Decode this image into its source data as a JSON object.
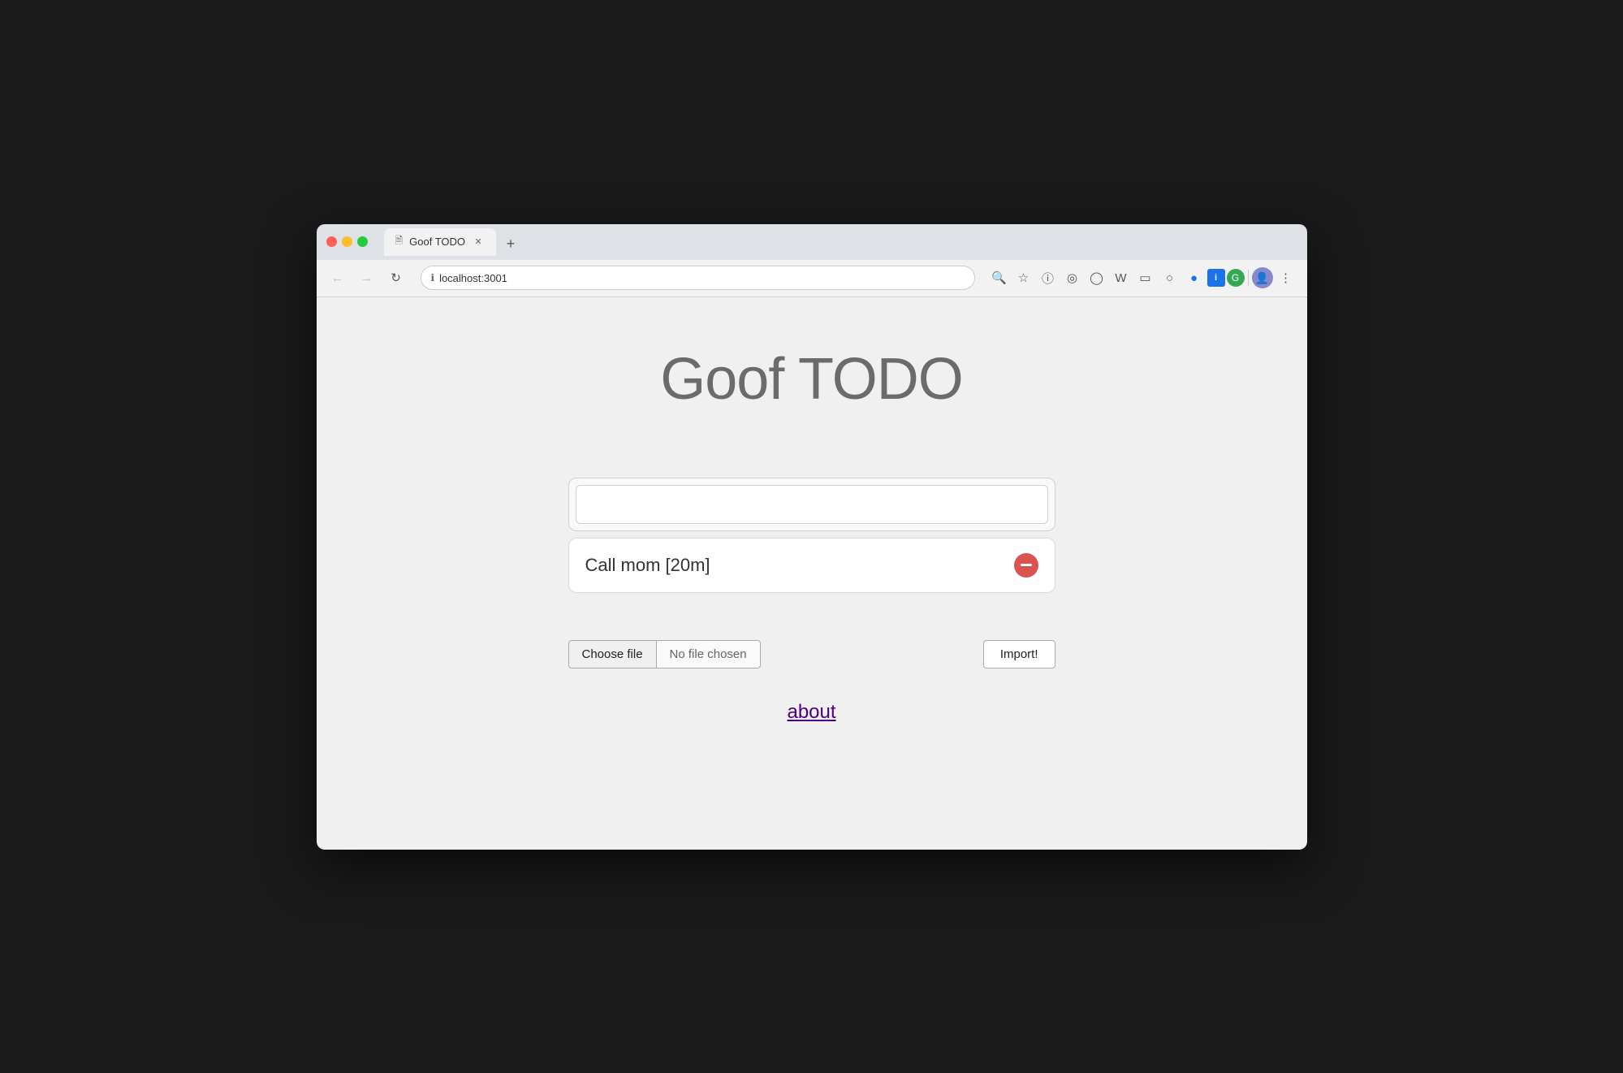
{
  "browser": {
    "tab_title": "Goof TODO",
    "url": "localhost:3001",
    "new_tab_symbol": "+",
    "back_symbol": "←",
    "forward_symbol": "→",
    "refresh_symbol": "↻"
  },
  "app": {
    "title": "Goof TODO",
    "input_placeholder": "",
    "todo_items": [
      {
        "text": "Call mom [20m]"
      }
    ],
    "file_input": {
      "choose_label": "Choose file",
      "no_file_text": "No file chosen"
    },
    "import_button": "Import!",
    "about_link": "about"
  }
}
